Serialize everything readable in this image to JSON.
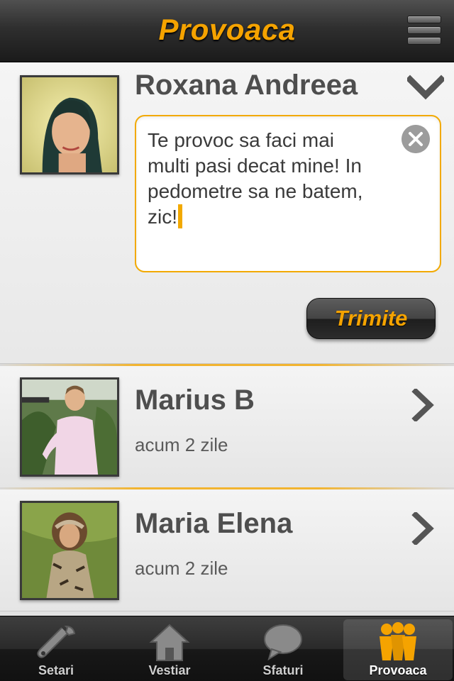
{
  "header": {
    "title": "Provoaca",
    "menu_icon": "hamburger-icon"
  },
  "challenge_compose": {
    "name": "Roxana Andreea",
    "message": "Te provoc sa faci mai multi pasi decat mine! In pedometre sa ne batem, zic!",
    "message_lines": [
      "Te provoc sa faci mai",
      "multi pasi decat mine! In",
      "pedometre sa ne batem,",
      "zic!"
    ],
    "clear_icon": "close-circle-icon",
    "collapse_icon": "chevron-down-icon",
    "send_label": "Trimite"
  },
  "challenges": [
    {
      "name": "Marius B",
      "time": "acum 2 zile",
      "icon": "chevron-right-icon"
    },
    {
      "name": "Maria Elena",
      "time": "acum 2 zile",
      "icon": "chevron-right-icon"
    }
  ],
  "tabs": [
    {
      "label": "Setari",
      "icon": "wrench-icon",
      "active": false
    },
    {
      "label": "Vestiar",
      "icon": "house-icon",
      "active": false
    },
    {
      "label": "Sfaturi",
      "icon": "speech-bubble-icon",
      "active": false
    },
    {
      "label": "Provoaca",
      "icon": "people-group-icon",
      "active": true
    }
  ],
  "colors": {
    "accent": "#f5a300",
    "header_bg": "#2f2f2f",
    "text_dark": "#4e4e4e",
    "input_border": "#f2a900"
  }
}
